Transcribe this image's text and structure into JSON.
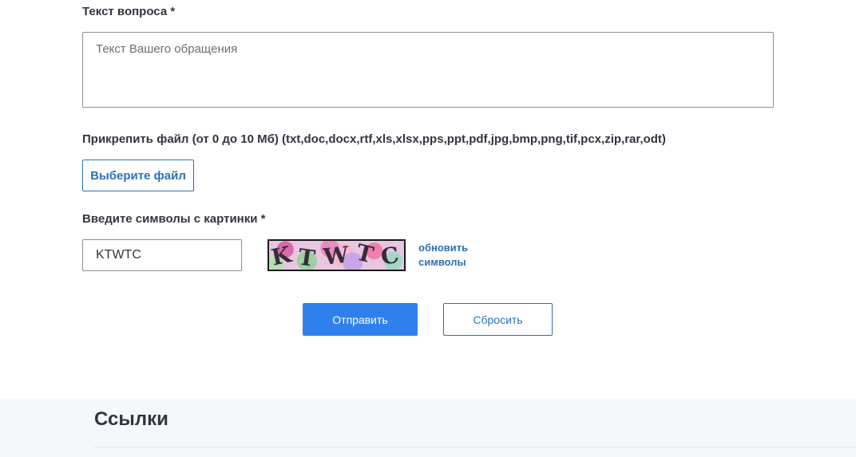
{
  "question": {
    "label": "Текст вопроса *",
    "placeholder": "Текст Вашего обращения",
    "value": ""
  },
  "attachment": {
    "label": "Прикрепить файл (от 0 до 10 Мб) (txt,doc,docx,rtf,xls,xlsx,pps,ppt,pdf,jpg,bmp,png,tif,pcx,zip,rar,odt)",
    "button_label": "Выберите файл"
  },
  "captcha": {
    "label": "Введите символы с картинки *",
    "value": "KTWTC",
    "image_chars": [
      "K",
      "T",
      "W",
      "T",
      "C"
    ],
    "refresh_label_line1": "обновить",
    "refresh_label_line2": "символы"
  },
  "actions": {
    "submit_label": "Отправить",
    "reset_label": "Сбросить"
  },
  "links_section": {
    "title": "Ссылки"
  },
  "colors": {
    "accent": "#2f80ed",
    "link": "#2d6fb7",
    "text": "#33343f",
    "section_bg": "#f5f8fb"
  }
}
